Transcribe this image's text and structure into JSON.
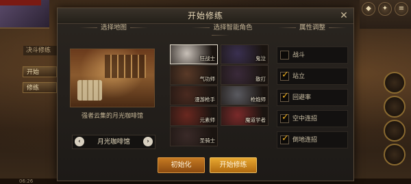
{
  "background": {
    "left_buttons": [
      "开始",
      "修练"
    ],
    "left_label": "决斗修练",
    "bottom_text": "06:26"
  },
  "modal": {
    "title": "开始修练",
    "close_icon": "close-icon"
  },
  "map_section": {
    "header": "选择地图",
    "description": "强者云集的月光咖啡馆",
    "selected_map": "月光咖啡馆",
    "prev_icon": "chevron-left-icon",
    "next_icon": "chevron-right-icon"
  },
  "character_section": {
    "header": "选择智能角色",
    "characters": [
      {
        "name": "狂战士",
        "selected": true,
        "color": "#c8c0b8"
      },
      {
        "name": "鬼泣",
        "selected": false,
        "color": "#3a3050"
      },
      {
        "name": "气功师",
        "selected": false,
        "color": "#5a3a28"
      },
      {
        "name": "散打",
        "selected": false,
        "color": "#3a2a3a"
      },
      {
        "name": "漫游枪手",
        "selected": false,
        "color": "#4a2a20"
      },
      {
        "name": "枪炮师",
        "selected": false,
        "color": "#5a5a60"
      },
      {
        "name": "元素师",
        "selected": false,
        "color": "#6a2820"
      },
      {
        "name": "魔道学者",
        "selected": false,
        "color": "#7a2a2a"
      },
      {
        "name": "圣骑士",
        "selected": false,
        "color": "#3a2a28"
      }
    ]
  },
  "attribute_section": {
    "header": "属性调整",
    "attributes": [
      {
        "label": "战斗",
        "checked": false
      },
      {
        "label": "站立",
        "checked": true
      },
      {
        "label": "回避率",
        "checked": true
      },
      {
        "label": "空中连招",
        "checked": true
      },
      {
        "label": "倒地连招",
        "checked": true
      }
    ]
  },
  "buttons": {
    "reset_label": "初始化",
    "start_label": "开始修练"
  }
}
